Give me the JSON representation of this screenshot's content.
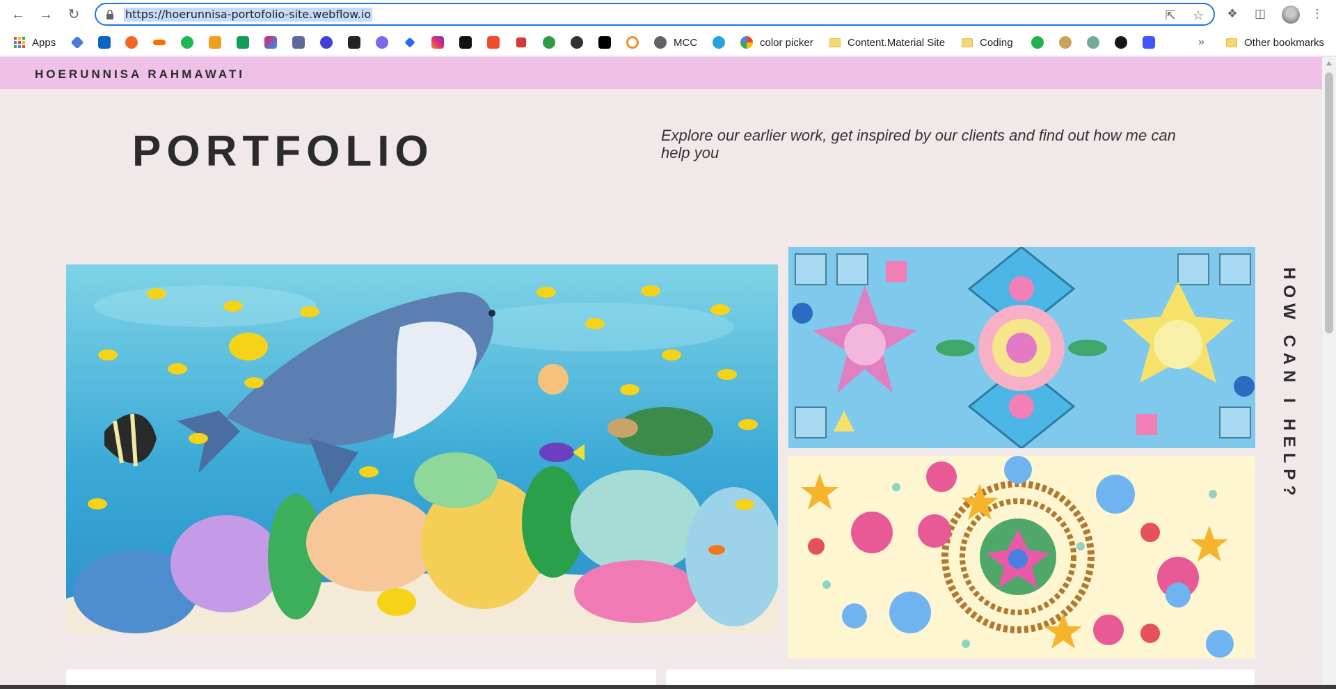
{
  "browser": {
    "url": "https://hoerunnisa-portofolio-site.webflow.io",
    "bookmarks": {
      "apps": "Apps",
      "mcc": "MCC",
      "color_picker": "color picker",
      "content_material": "Content.Material Site",
      "coding": "Coding",
      "other": "Other bookmarks"
    }
  },
  "site": {
    "brand": "HOERUNNISA RAHMAWATI",
    "title": "PORTFOLIO",
    "intro": "Explore our earlier work, get inspired by our clients and find out how me can help you",
    "side_heading": "HOW CAN I HELP?"
  },
  "colors": {
    "header_bg": "#efc1e9",
    "page_bg": "#f1e9e9",
    "focus_ring": "#1a73e8"
  }
}
